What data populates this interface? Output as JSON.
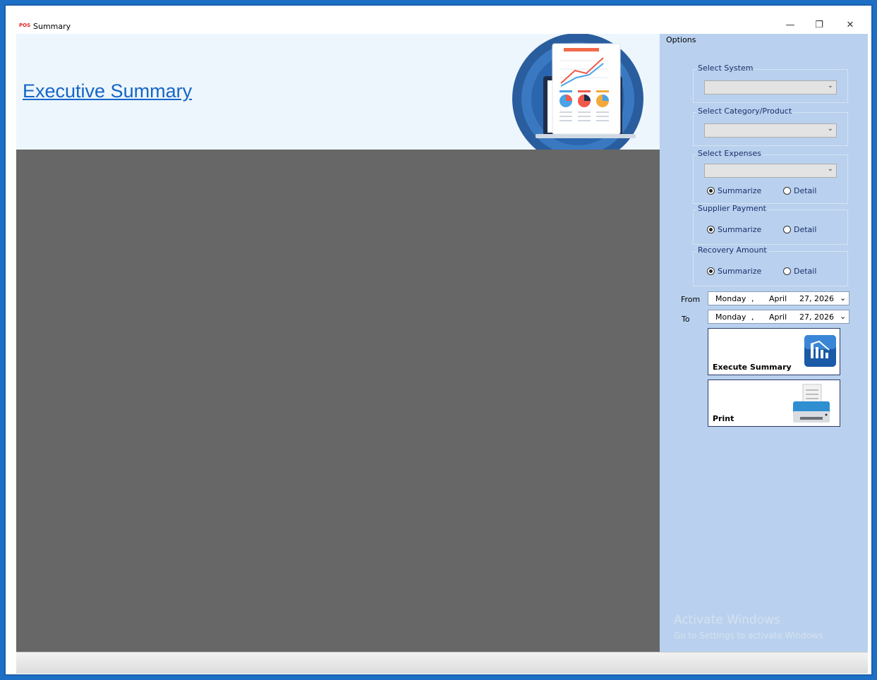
{
  "window": {
    "app_logo": "POS",
    "title": "Summary",
    "minimize": "—",
    "restore": "❐",
    "close": "✕"
  },
  "banner": {
    "title": "Executive Summary"
  },
  "options": {
    "label": "Options",
    "select_system": {
      "label": "Select System",
      "value": ""
    },
    "select_category": {
      "label": "Select Category/Product",
      "value": ""
    },
    "select_expenses": {
      "label": "Select  Expenses",
      "value": "",
      "summarize_label": "Summarize",
      "detail_label": "Detail",
      "selected": "Summarize"
    },
    "supplier_payment": {
      "label": "Supplier Payment",
      "summarize_label": "Summarize",
      "detail_label": "Detail",
      "selected": "Summarize"
    },
    "recovery_amount": {
      "label": "Recovery Amount",
      "summarize_label": "Summarize",
      "detail_label": "Detail",
      "selected": "Summarize"
    },
    "from": {
      "label": "From",
      "weekday": "Monday",
      "sep": ",",
      "month": "April",
      "day_year": "27, 2026"
    },
    "to": {
      "label": "To",
      "weekday": "Monday",
      "sep": ",",
      "month": "April",
      "day_year": "27, 2026"
    },
    "execute_button": {
      "label": "Execute Summary",
      "icon": "chart-report-icon"
    },
    "print_button": {
      "label": "Print",
      "icon": "printer-icon"
    }
  },
  "watermark": {
    "title": "Activate Windows",
    "subtitle": "Go to Settings to activate Windows."
  },
  "colors": {
    "accent": "#1565c8",
    "panel": "#b9d1ee",
    "content": "#676767",
    "banner": "#edf6fc"
  }
}
